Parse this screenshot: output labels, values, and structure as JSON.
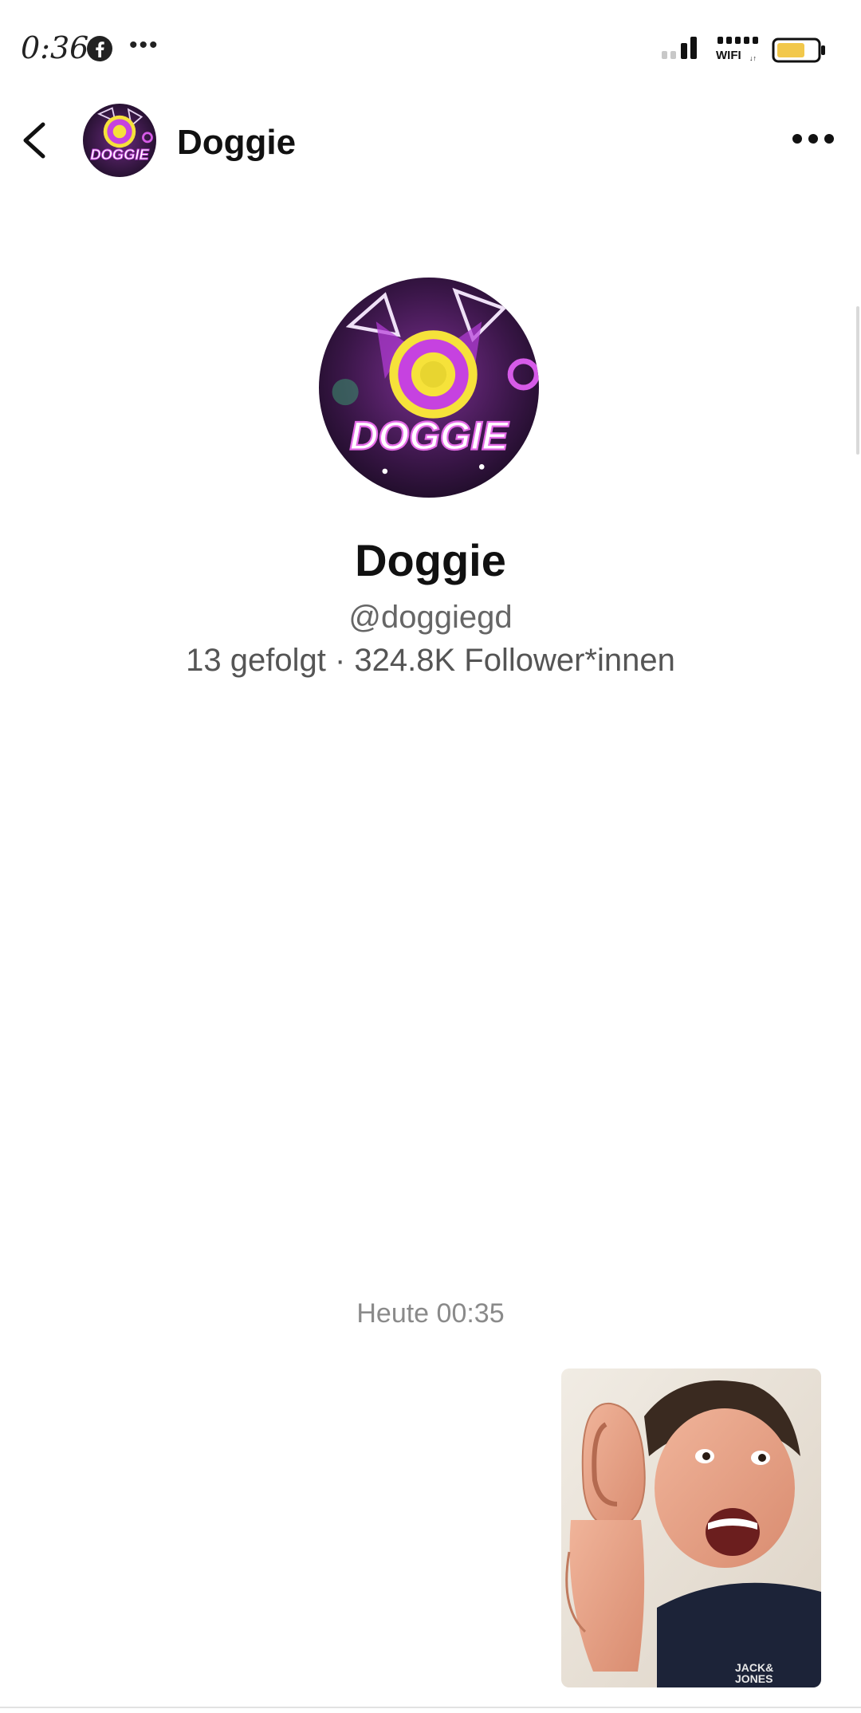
{
  "status_bar": {
    "time": "0:36",
    "notification_icon": "facebook-icon",
    "overflow_icon": "more-dots-icon",
    "signal_icon": "signal-bars-icon",
    "wifi_icon": "wifi-icon",
    "battery_icon": "battery-icon"
  },
  "header": {
    "back_icon": "chevron-left-icon",
    "name": "Doggie",
    "more_icon": "more-horizontal-icon"
  },
  "profile": {
    "name": "Doggie",
    "handle": "@doggiegd",
    "stats": "13 gefolgt · 324.8K Follower*innen"
  },
  "chat": {
    "timestamp": "Heute 00:35",
    "image_icon": "photo-message-icon"
  },
  "colors": {
    "accent_purple": "#b53cd8",
    "accent_yellow": "#f6e23a",
    "text_secondary": "#666666",
    "timestamp_gray": "#8a8a8a"
  }
}
